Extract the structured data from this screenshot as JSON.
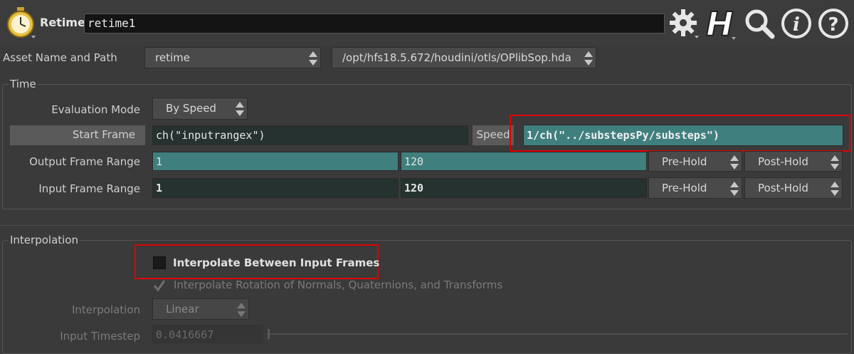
{
  "header": {
    "node_type_label": "Retime",
    "node_name": "retime1",
    "icons": [
      "stopwatch-icon",
      "gear-icon",
      "houdini-h-icon",
      "search-icon",
      "info-icon",
      "help-icon"
    ]
  },
  "asset": {
    "label": "Asset Name and Path",
    "name": "retime",
    "path": "/opt/hfs18.5.672/houdini/otls/OPlibSop.hda"
  },
  "time": {
    "title": "Time",
    "evaluation_mode_label": "Evaluation Mode",
    "evaluation_mode_value": "By Speed",
    "start_frame_label": "Start Frame",
    "start_frame_value": "ch(\"inputrangex\")",
    "speed_label": "Speed",
    "speed_value": "1/ch(\"../substepsPy/substeps\")",
    "output_range_label": "Output Frame Range",
    "output_range_start": "1",
    "output_range_end": "120",
    "input_range_label": "Input Frame Range",
    "input_range_start": "1",
    "input_range_end": "120",
    "pre_hold": "Pre-Hold",
    "post_hold": "Post-Hold"
  },
  "interpolation": {
    "title": "Interpolation",
    "interp_between_label": "Interpolate Between Input Frames",
    "interp_rotation_label": "Interpolate Rotation of Normals, Quaternions, and Transforms",
    "interpolation_label": "Interpolation",
    "interpolation_value": "Linear",
    "input_timestep_label": "Input Timestep",
    "input_timestep_value": "0.0416667"
  },
  "colors": {
    "highlight": "#e00000",
    "teal_field": "#3f7f7d",
    "dark_field": "#26322f"
  }
}
